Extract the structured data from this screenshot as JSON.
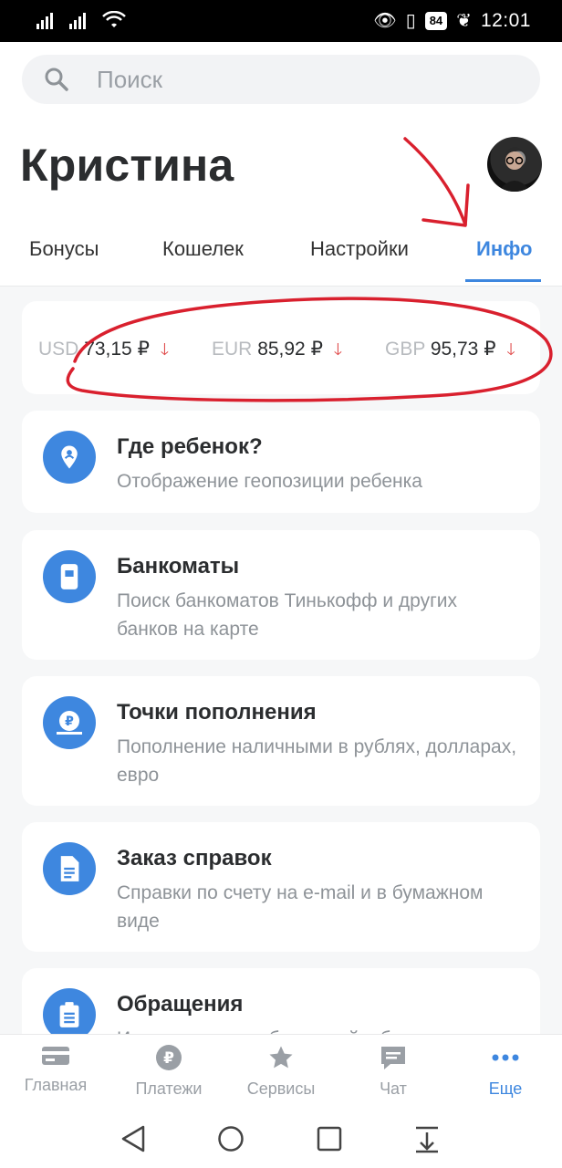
{
  "status_bar": {
    "time": "12:01",
    "battery": "84"
  },
  "search": {
    "placeholder": "Поиск"
  },
  "profile": {
    "name": "Кристина"
  },
  "tabs": [
    {
      "label": "Бонусы",
      "active": false
    },
    {
      "label": "Кошелек",
      "active": false
    },
    {
      "label": "Настройки",
      "active": false
    },
    {
      "label": "Инфо",
      "active": true
    }
  ],
  "rates": [
    {
      "code": "USD",
      "value": "73,15 ₽",
      "trend": "down"
    },
    {
      "code": "EUR",
      "value": "85,92 ₽",
      "trend": "down"
    },
    {
      "code": "GBP",
      "value": "95,73 ₽",
      "trend": "down"
    }
  ],
  "cards": [
    {
      "title": "Где ребенок?",
      "desc": "Отображение геопозиции ребенка",
      "icon": "location-pin-icon"
    },
    {
      "title": "Банкоматы",
      "desc": "Поиск банкоматов Тинькофф и других банков на карте",
      "icon": "atm-icon"
    },
    {
      "title": "Точки пополнения",
      "desc": "Пополнение наличными в рублях, долларах, евро",
      "icon": "ruble-cash-icon"
    },
    {
      "title": "Заказ справок",
      "desc": "Справки по счету на e-mail и в бумажном виде",
      "icon": "document-icon"
    },
    {
      "title": "Обращения",
      "desc": "История ваших обращений в банк",
      "icon": "clipboard-icon"
    }
  ],
  "bottom_nav": [
    {
      "label": "Главная",
      "icon": "card-icon",
      "active": false
    },
    {
      "label": "Платежи",
      "icon": "ruble-icon",
      "active": false
    },
    {
      "label": "Сервисы",
      "icon": "star-icon",
      "active": false
    },
    {
      "label": "Чат",
      "icon": "chat-icon",
      "active": false
    },
    {
      "label": "Еще",
      "icon": "more-dots-icon",
      "active": true
    }
  ],
  "colors": {
    "accent": "#3e87df",
    "down_arrow": "#e04a4a",
    "annotation": "#d9202e"
  }
}
